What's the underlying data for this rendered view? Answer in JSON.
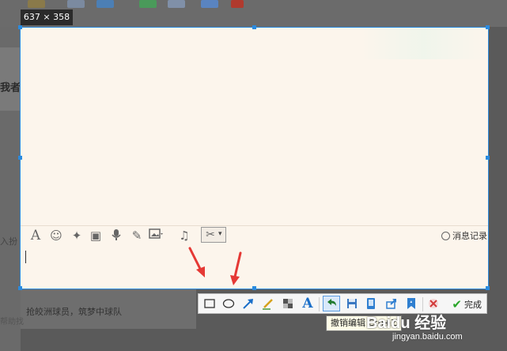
{
  "capture": {
    "size_label": "637 × 358"
  },
  "background": {
    "left_fragment_1": "我者是",
    "left_fragment_2": "入扮",
    "bottom_text": "抢皎洲球员，筑梦中球队",
    "bottom_fragment": "帮助找"
  },
  "chat_toolbar": {
    "icons": [
      "font-icon",
      "emoji-icon",
      "magic-icon",
      "video-icon",
      "mic-icon",
      "edit-icon",
      "image-icon",
      "music-icon",
      "scissors-icon"
    ],
    "history_label": "消息记录"
  },
  "screenshot_toolbar": {
    "tools": [
      "rectangle-icon",
      "ellipse-icon",
      "arrow-icon",
      "pen-icon",
      "mosaic-icon",
      "text-icon",
      "undo-icon",
      "save-icon",
      "pin-icon",
      "share-icon",
      "favorite-icon",
      "cancel-icon"
    ],
    "finish_label": "完成",
    "tooltip": "撤销编辑 Ctrl+Z"
  },
  "watermark": {
    "main": "Baidu 经验",
    "sub": "jingyan.baidu.com"
  },
  "colors": {
    "selection_border": "#2a8be0",
    "arrow": "#e53935",
    "finish_check": "#2aa52a"
  }
}
